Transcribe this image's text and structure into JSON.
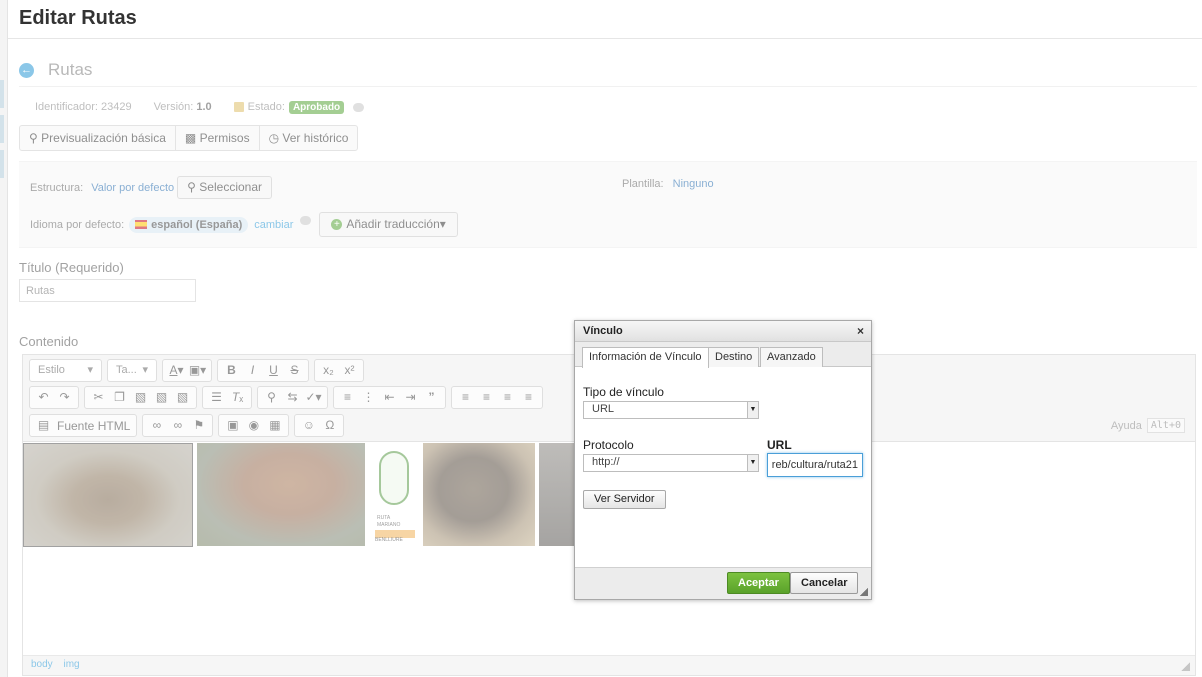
{
  "page": {
    "title": "Editar Rutas"
  },
  "article": {
    "back_icon": "arrow-left-circle-icon",
    "name": "Rutas",
    "meta": {
      "id_label": "Identificador:",
      "id_value": "23429",
      "version_label": "Versión:",
      "version_value": "1.0",
      "estado_label": "Estado:",
      "estado_value": "Aprobado"
    },
    "actions": [
      "Previsualización básica",
      "Permisos",
      "Ver histórico"
    ]
  },
  "structure": {
    "estructura_label": "Estructura:",
    "estructura_value": "Valor por defecto",
    "seleccionar": "Seleccionar",
    "plantilla_label": "Plantilla:",
    "plantilla_value": "Ninguno",
    "idioma_label": "Idioma por defecto:",
    "idioma_value": "español (España)",
    "cambiar": "cambiar",
    "add_translation": "Añadir traducción"
  },
  "form": {
    "title_label": "Título (Requerido)",
    "title_value": "Rutas",
    "content_label": "Contenido"
  },
  "editor": {
    "style_dropdown": "Estilo",
    "size_dropdown": "Ta...",
    "fuente_html": "Fuente HTML",
    "help_label": "Ayuda",
    "help_shortcut": "Alt+0",
    "statusbar": [
      "body",
      "img"
    ],
    "image_caption_lines": [
      "RUTA",
      "MARIANO",
      "BENLLIURE"
    ]
  },
  "dialog": {
    "title": "Vínculo",
    "tabs": [
      "Información de Vínculo",
      "Destino",
      "Avanzado"
    ],
    "tipo_label": "Tipo de vínculo",
    "tipo_value": "URL",
    "protocolo_label": "Protocolo",
    "protocolo_value": "http://",
    "url_label": "URL",
    "url_value": "reb/cultura/ruta21",
    "ver_servidor": "Ver Servidor",
    "ok": "Aceptar",
    "cancel": "Cancelar"
  },
  "colors": {
    "accent": "#2d9ad6",
    "approved": "#5aa73c",
    "ok_button": "#6bb436"
  }
}
